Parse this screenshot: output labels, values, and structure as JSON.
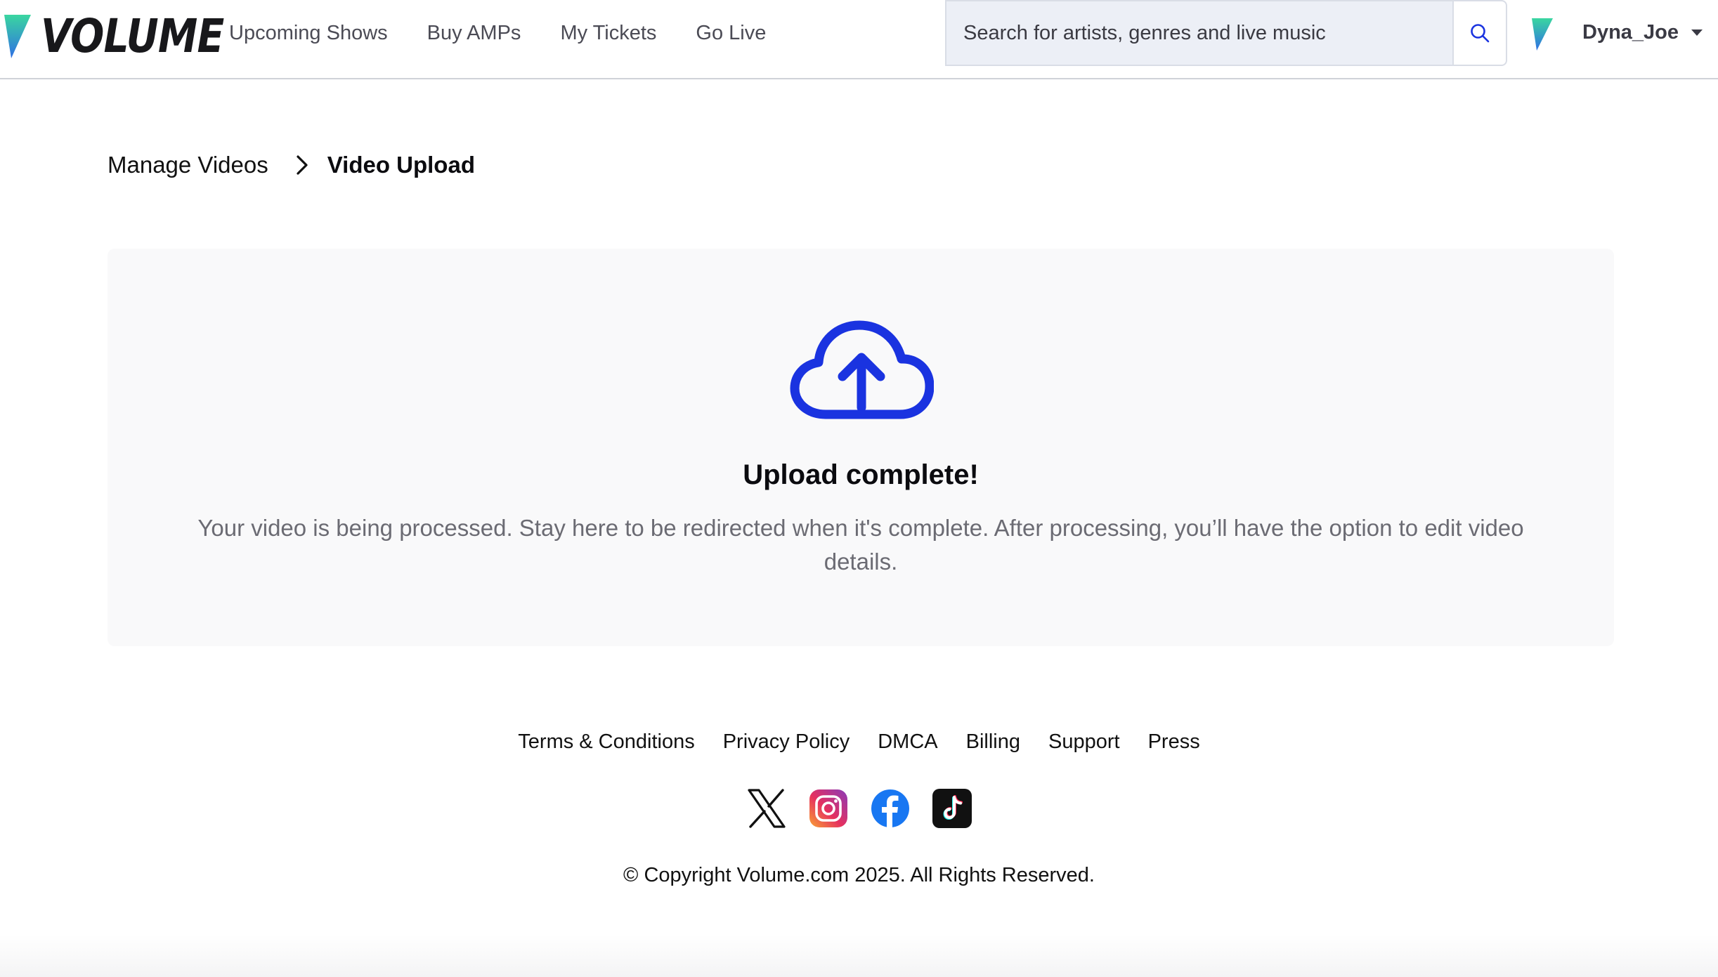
{
  "header": {
    "logo_text": "VOLUME",
    "nav": [
      {
        "label": "Upcoming Shows"
      },
      {
        "label": "Buy AMPs"
      },
      {
        "label": "My Tickets"
      },
      {
        "label": "Go Live"
      }
    ],
    "search": {
      "placeholder": "Search for artists, genres and live music",
      "value": ""
    },
    "user": {
      "name": "Dyna_Joe"
    }
  },
  "breadcrumb": {
    "parent": "Manage Videos",
    "current": "Video Upload"
  },
  "upload": {
    "icon": "cloud-upload-icon",
    "title": "Upload complete!",
    "message": "Your video is being processed. Stay here to be redirected when it's complete. After processing, you’ll have the option to edit video details."
  },
  "footer": {
    "links": [
      {
        "label": "Terms & Conditions"
      },
      {
        "label": "Privacy Policy"
      },
      {
        "label": "DMCA"
      },
      {
        "label": "Billing"
      },
      {
        "label": "Support"
      },
      {
        "label": "Press"
      }
    ],
    "socials": [
      "x-icon",
      "instagram-icon",
      "facebook-icon",
      "tiktok-icon"
    ],
    "copyright": "© Copyright Volume.com 2025. All Rights Reserved."
  },
  "colors": {
    "accent_blue": "#1a33e0",
    "card_bg": "#f9f9fa",
    "search_bg": "#eceff6",
    "muted_text": "#6b6b73"
  }
}
